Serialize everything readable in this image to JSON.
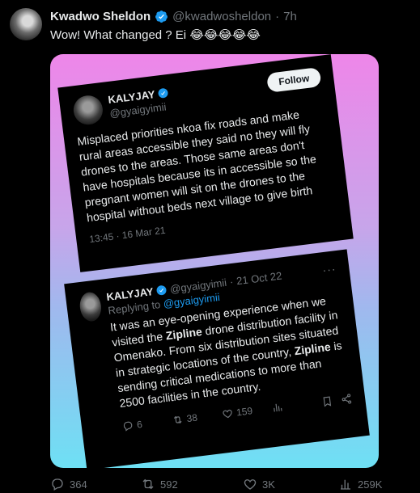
{
  "tweet": {
    "author_name": "Kwadwo Sheldon",
    "handle": "@kwadwosheldon",
    "separator": "·",
    "time": "7h",
    "text": "Wow! What changed ? Ei",
    "emojis": "😂😂😂😂😂"
  },
  "card1": {
    "name": "KALYJAY",
    "handle": "@gyaigyimii",
    "follow_label": "Follow",
    "text": "Misplaced priorities nkoa fix roads and make rural areas accessible they said no they will fly drones to the areas. Those same areas don't have hospitals because its in accessible so the pregnant women will sit on the drones to the hospital without beds next village to give birth",
    "meta": "13:45 · 16 Mar 21"
  },
  "card2": {
    "name": "KALYJAY",
    "handle": "@gyaigyimii",
    "separator": "·",
    "date": "21 Oct 22",
    "more": "···",
    "replying_prefix": "Replying to",
    "replying_handle": "@gyaigyimii",
    "text_a": "It was an eye-opening experience when we visited the ",
    "bold_1": "Zipline",
    "text_b": " drone distribution facility in Omenako. From six distribution sites situated in strategic locations of the country, ",
    "bold_2": "Zipline",
    "text_c": " is sending critical medications to more than 2500 facilities in the country.",
    "replies": "6",
    "retweets": "38",
    "likes": "159"
  },
  "actions": {
    "replies": "364",
    "reposts": "592",
    "likes": "3K",
    "views": "259K"
  },
  "colors": {
    "accent": "#1d9bf0",
    "muted": "#71767b",
    "text": "#e7e9ea"
  }
}
